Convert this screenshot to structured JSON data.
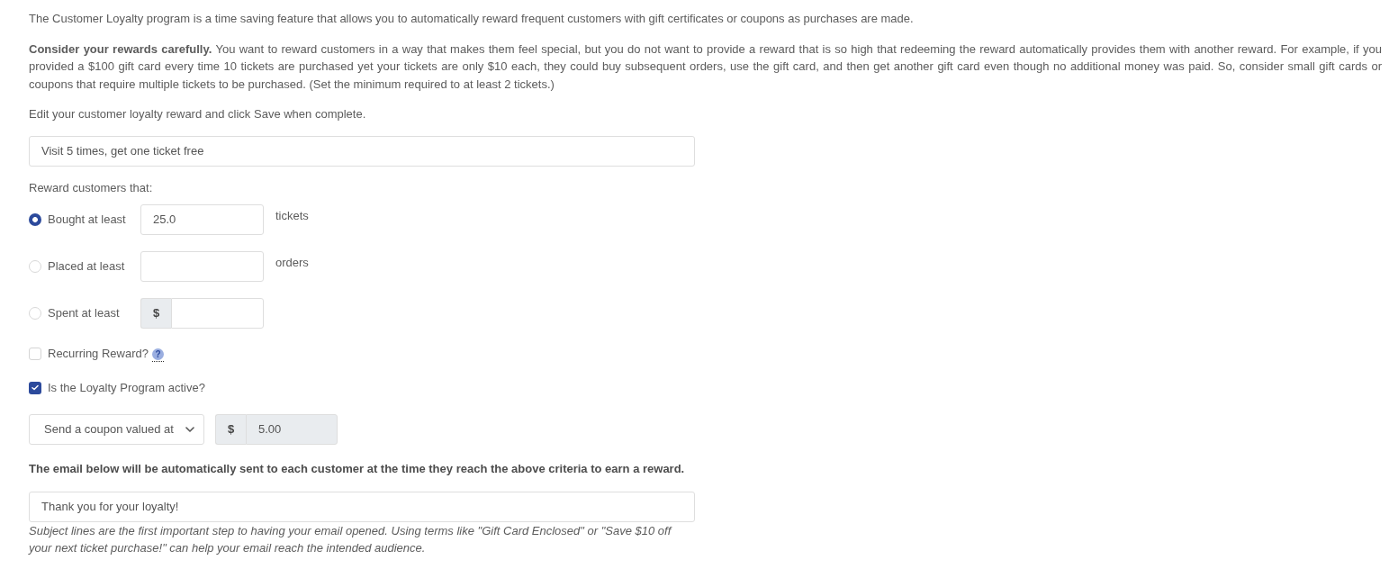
{
  "intro": "The Customer Loyalty program is a time saving feature that allows you to automatically reward frequent customers with gift certificates or coupons as purchases are made.",
  "warning": "**Consider your rewards carefully.** You want to reward customers in a way that makes them feel special, but you do not want to provide a reward that is so high that redeeming the reward automatically provides them with another reward. For example, if you provided a $100 gift card every time 10 tickets are purchased yet your tickets are only $10 each, they could buy subsequent orders, use the gift card, and then get another gift card even though no additional money was paid. So, consider small gift cards or coupons that require multiple tickets to be purchased. (Set the minimum required to at least 2 tickets.)",
  "instruction": "Edit your customer loyalty reward and click Save when complete.",
  "reward_name": {
    "value": "Visit 5 times, get one ticket free"
  },
  "criteria_label": "Reward customers that:",
  "criteria": [
    {
      "label": "Bought at least",
      "selected": true,
      "kind": "plain",
      "value": "25.0",
      "unit": "tickets"
    },
    {
      "label": "Placed at least",
      "selected": false,
      "kind": "plain",
      "unit": "orders"
    },
    {
      "label": "Spent at least",
      "selected": false,
      "kind": "currency",
      "prefix": "$"
    }
  ],
  "options": [
    {
      "label": "Recurring Reward?",
      "checked": false,
      "help": "?"
    },
    {
      "label": "Is the Loyalty Program active?",
      "checked": true
    }
  ],
  "reward_type": {
    "value": "Send a coupon valued at"
  },
  "reward_value": {
    "prefix": "$",
    "value": "5.00",
    "disabled": true
  },
  "email_note": "The email below will be automatically sent to each customer at the time they reach the above criteria to earn a reward.",
  "email_subject": {
    "value": "Thank you for your loyalty!"
  },
  "subject_help": "Subject lines are the first important step to having your email opened. Using terms like \"Gift Card Enclosed\" or \"Save $10 off your next ticket purchase!\" can help your email reach the intended audience."
}
